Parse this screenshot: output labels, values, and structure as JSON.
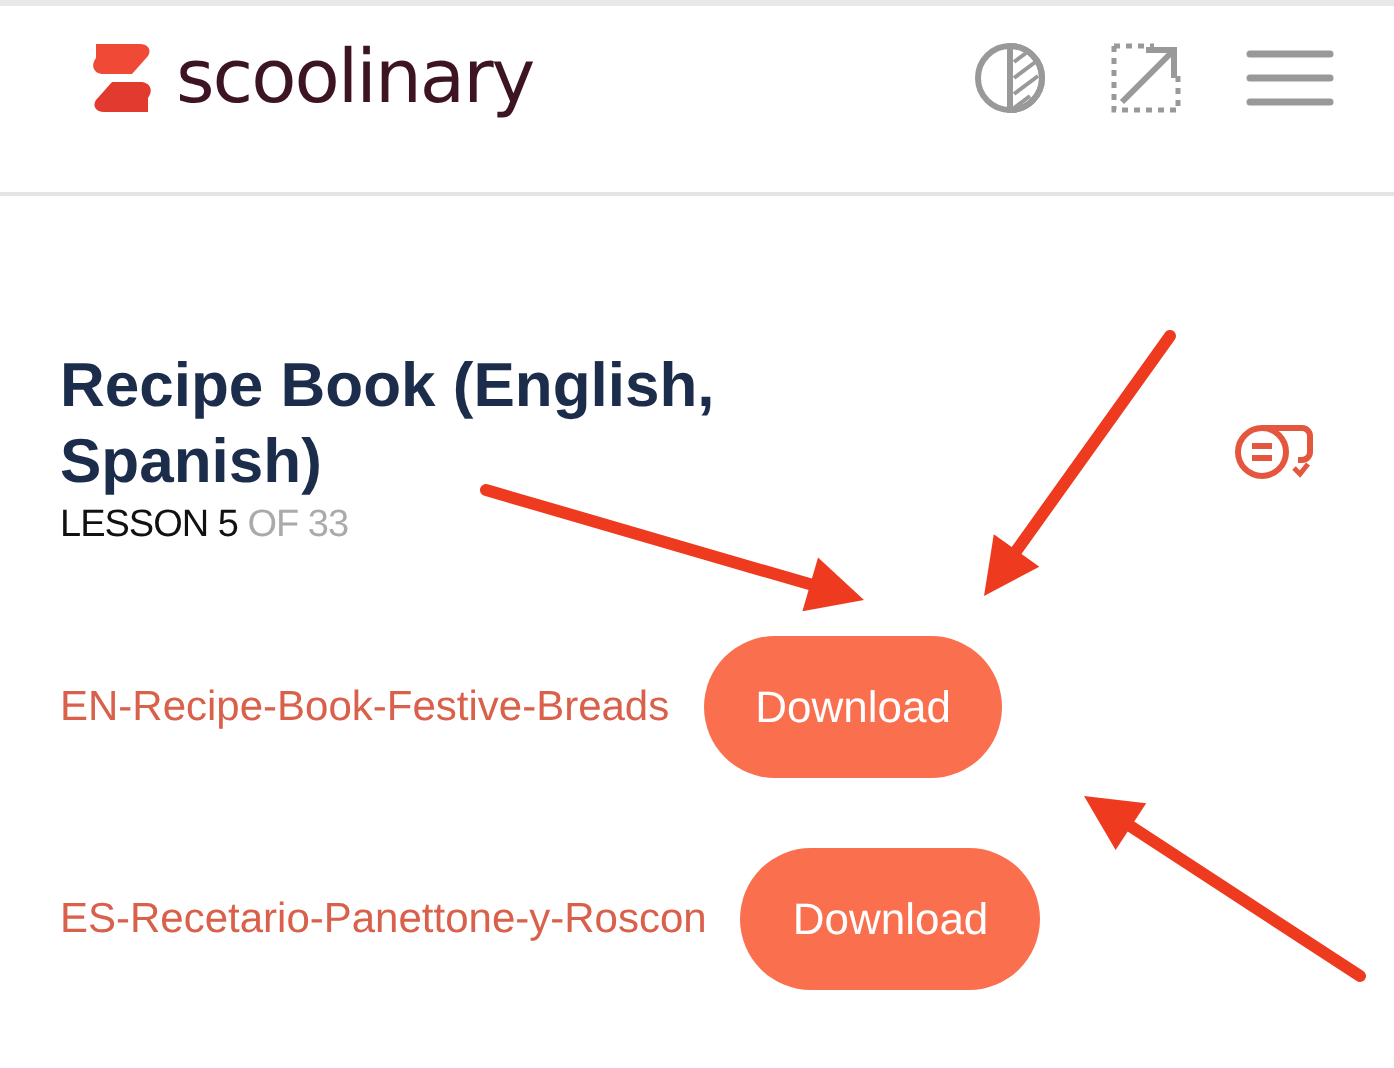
{
  "header": {
    "brand": "scoolinary"
  },
  "lesson": {
    "title": "Recipe Book (English, Spanish)",
    "progress_current": "LESSON 5",
    "progress_total": "OF 33"
  },
  "files": [
    {
      "name": "EN-Recipe-Book-Festive-Breads",
      "button": "Download"
    },
    {
      "name": "ES-Recetario-Panettone-y-Roscon",
      "button": "Download"
    }
  ]
}
